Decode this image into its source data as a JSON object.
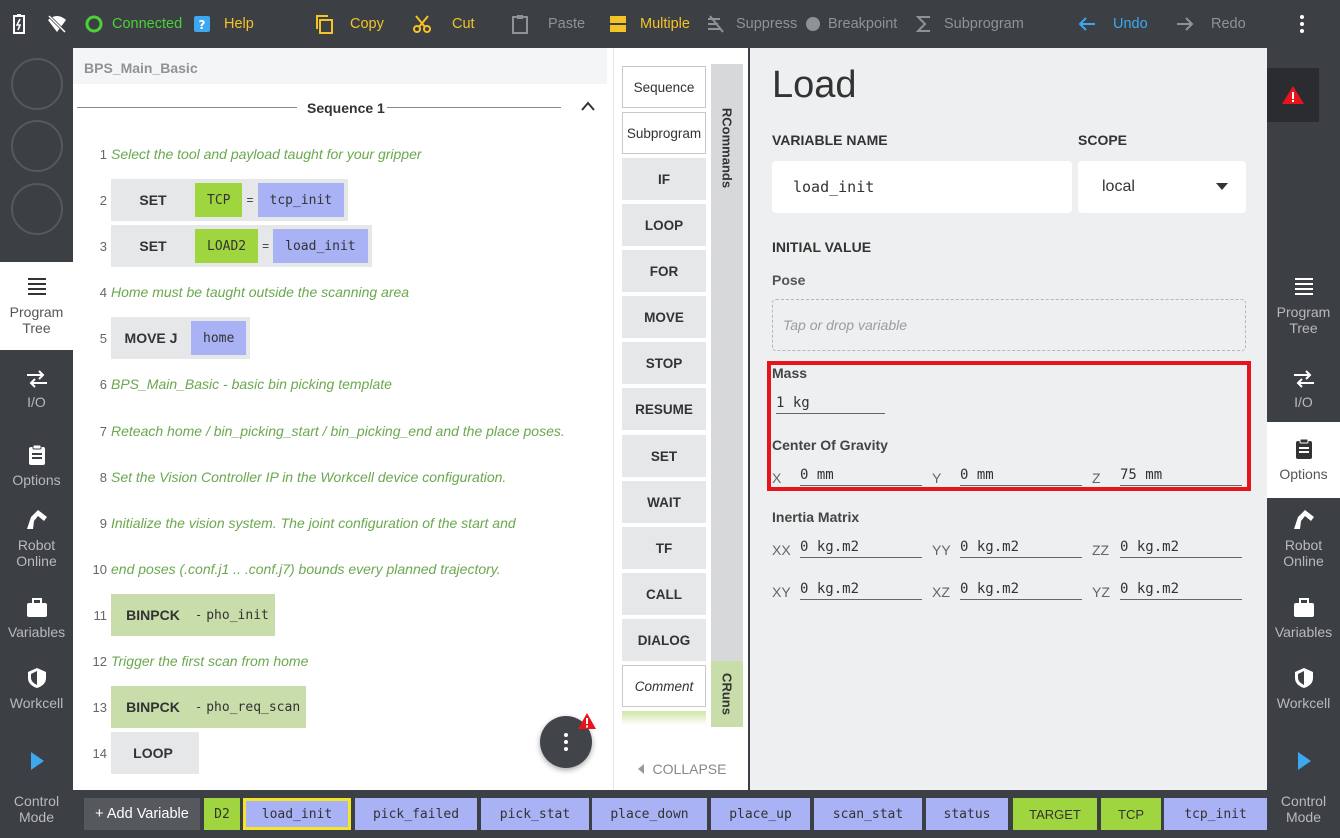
{
  "topbar": {
    "connected": "Connected",
    "help": "Help",
    "copy": "Copy",
    "cut": "Cut",
    "paste": "Paste",
    "multiple": "Multiple",
    "suppress": "Suppress",
    "breakpoint": "Breakpoint",
    "subprogram": "Subprogram",
    "undo": "Undo",
    "redo": "Redo"
  },
  "left_nav": [
    {
      "label": "Program\nTree"
    },
    {
      "label": "I/O"
    },
    {
      "label": "Options"
    },
    {
      "label": "Robot\nOnline"
    },
    {
      "label": "Variables"
    },
    {
      "label": "Workcell"
    },
    {
      "label": "Control\nMode"
    }
  ],
  "program": {
    "title": "BPS_Main_Basic",
    "sequence": "Sequence 1",
    "lines": [
      {
        "n": "1",
        "comment": "Select the tool and payload taught for your gripper"
      },
      {
        "n": "2",
        "kw": "SET",
        "lhs": "TCP",
        "eq": "=",
        "rhs": "tcp_init"
      },
      {
        "n": "3",
        "kw": "SET",
        "lhs": "LOAD2",
        "eq": "=",
        "rhs": "load_init"
      },
      {
        "n": "4",
        "comment": "Home must be taught outside the scanning area"
      },
      {
        "n": "5",
        "kw": "MOVE J",
        "rhs": "home"
      },
      {
        "n": "6",
        "comment": "BPS_Main_Basic - basic bin picking template"
      },
      {
        "n": "7",
        "comment": "Reteach home / bin_picking_start / bin_picking_end and the place poses."
      },
      {
        "n": "8",
        "comment": "Set the Vision Controller IP in the Workcell device configuration."
      },
      {
        "n": "9",
        "comment": "Initialize the vision system. The joint configuration of the start and"
      },
      {
        "n": "10",
        "comment": "end poses (.conf.j1 .. .conf.j7) bounds every planned trajectory."
      },
      {
        "n": "11",
        "kw": "BINPCK",
        "dash": "-",
        "arg": "pho_init"
      },
      {
        "n": "12",
        "comment": "Trigger the first scan from home"
      },
      {
        "n": "13",
        "kw": "BINPCK",
        "dash": "-",
        "arg": "pho_req_scan"
      },
      {
        "n": "14",
        "kw": "LOOP"
      }
    ]
  },
  "commands": {
    "items": [
      "Sequence",
      "Subprogram",
      "IF",
      "LOOP",
      "FOR",
      "MOVE",
      "STOP",
      "RESUME",
      "SET",
      "WAIT",
      "TF",
      "CALL",
      "DIALOG",
      "Comment"
    ],
    "tab_rcommands": "RCommands",
    "tab_cruns": "CRuns",
    "collapse": "COLLAPSE"
  },
  "load": {
    "title": "Load",
    "variable_name_label": "VARIABLE NAME",
    "variable_name": "load_init",
    "scope_label": "SCOPE",
    "scope": "local",
    "initial_value_label": "INITIAL VALUE",
    "pose_label": "Pose",
    "pose_placeholder": "Tap or drop variable",
    "mass_label": "Mass",
    "mass": "1 kg",
    "cog_label": "Center Of Gravity",
    "cog": {
      "x_label": "X",
      "x": "0 mm",
      "y_label": "Y",
      "y": "0 mm",
      "z_label": "Z",
      "z": "75 mm"
    },
    "inertia_label": "Inertia Matrix",
    "inertia": [
      {
        "label": "XX",
        "value": "0 kg.m2"
      },
      {
        "label": "YY",
        "value": "0 kg.m2"
      },
      {
        "label": "ZZ",
        "value": "0 kg.m2"
      },
      {
        "label": "XY",
        "value": "0 kg.m2"
      },
      {
        "label": "XZ",
        "value": "0 kg.m2"
      },
      {
        "label": "YZ",
        "value": "0 kg.m2"
      }
    ]
  },
  "varbar": {
    "add": "+ Add Variable",
    "chips": [
      {
        "label": "D2",
        "color": "green"
      },
      {
        "label": "load_init",
        "color": "purple",
        "selected": true
      },
      {
        "label": "pick_failed",
        "color": "purple"
      },
      {
        "label": "pick_stat",
        "color": "purple"
      },
      {
        "label": "place_down",
        "color": "purple"
      },
      {
        "label": "place_up",
        "color": "purple"
      },
      {
        "label": "scan_stat",
        "color": "purple"
      },
      {
        "label": "status",
        "color": "purple"
      },
      {
        "label": "TARGET",
        "color": "green"
      },
      {
        "label": "TCP",
        "color": "green"
      },
      {
        "label": "tcp_init",
        "color": "purple"
      }
    ]
  },
  "colors": {
    "accent_yellow": "#f4c425",
    "connected_green": "#4cd137",
    "undo_blue": "#3da7f0",
    "highlight_red": "#e8141b"
  }
}
